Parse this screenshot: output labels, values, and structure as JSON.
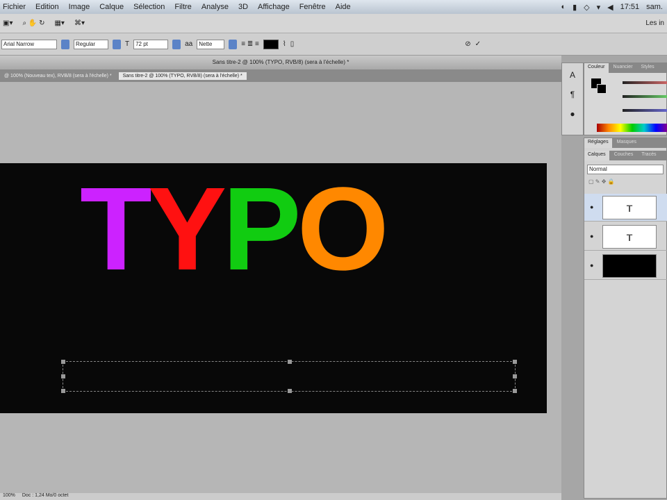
{
  "menubar": {
    "items": [
      "Fichier",
      "Edition",
      "Image",
      "Calque",
      "Sélection",
      "Filtre",
      "Analyse",
      "3D",
      "Affichage",
      "Fenêtre",
      "Aide"
    ],
    "status": [
      "◐",
      "▮",
      "◇",
      "▾",
      "◀",
      "17:51",
      "sam."
    ]
  },
  "appbar": {
    "workspace": "Les in"
  },
  "options": {
    "font": "Arial Narrow",
    "style": "Regular",
    "size": "72 pt",
    "aa": "Nette"
  },
  "document": {
    "title": "Sans titre-2 @ 100% (TYPO, RVB/8) (sera à l'échelle) *",
    "tabs": [
      "@ 100% (Nouveau tex), RVB/8 (sera à l'échelle) *",
      "Sans titre-2 @ 100% (TYPO, RVB/8) (sera à l'échelle) *"
    ]
  },
  "canvas": {
    "letters": [
      {
        "char": "T",
        "color": "#cc22ff"
      },
      {
        "char": "Y",
        "color": "#ff1111"
      },
      {
        "char": "P",
        "color": "#11cc11"
      },
      {
        "char": "O",
        "color": "#ff8800"
      }
    ]
  },
  "status": {
    "zoom": "100%",
    "info": "Doc : 1,24 Mo/0 octet"
  },
  "panels": {
    "color_tabs": [
      "Couleur",
      "Nuancier",
      "Styles"
    ],
    "layers_tabs": [
      "Calques",
      "Couches",
      "Tracés"
    ],
    "adjust_tabs": [
      "Réglages",
      "Masques"
    ],
    "blend": "Normal",
    "layers": [
      {
        "thumb": "T"
      },
      {
        "thumb": "T"
      },
      {
        "thumb": ""
      }
    ]
  }
}
